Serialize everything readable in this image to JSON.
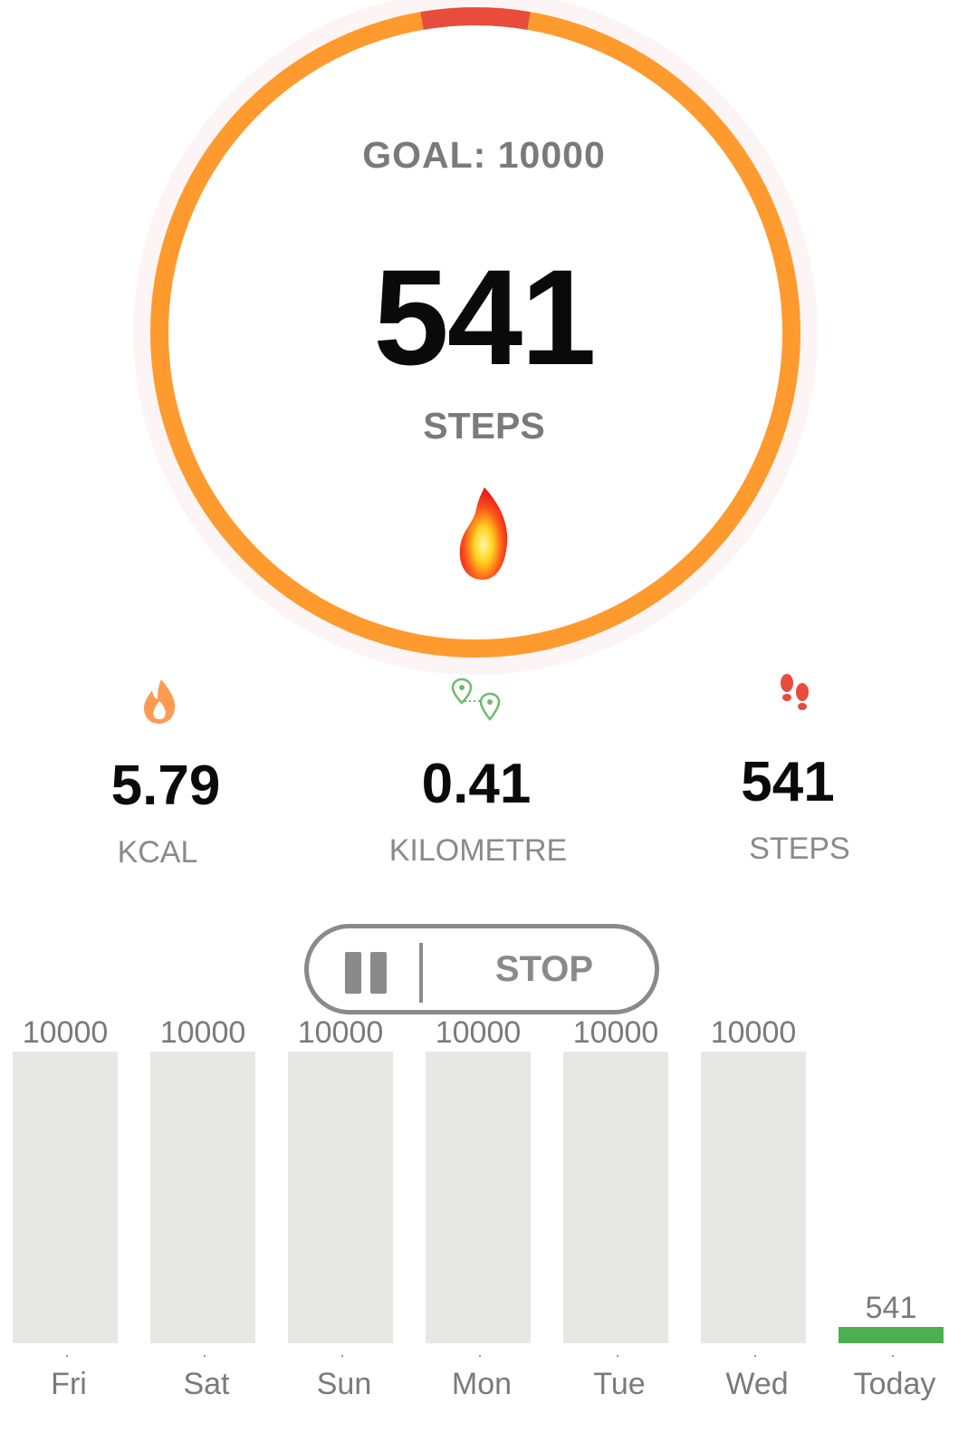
{
  "goal_text": "GOAL: 10000",
  "current_steps": "541",
  "steps_label": "STEPS",
  "progress_fraction": 0.0541,
  "colors": {
    "ring": "#ff9a2e",
    "ring_progress": "#e84c3d",
    "ring_shadow": "#fdf5f5",
    "bar_empty": "#e7e8e6",
    "bar_today": "#4caf50",
    "label_gray": "#8a8a8a"
  },
  "stats": [
    {
      "icon": "fire-icon",
      "value": "5.79",
      "label": "KCAL"
    },
    {
      "icon": "route-pins-icon",
      "value": "0.41",
      "label": "KILOMETRE"
    },
    {
      "icon": "footprints-icon",
      "value": "541",
      "label": "STEPS"
    }
  ],
  "controls": {
    "pause_icon": "pause-icon",
    "stop_label": "STOP"
  },
  "chart_data": {
    "type": "bar",
    "categories": [
      "Fri",
      "Sat",
      "Sun",
      "Mon",
      "Tue",
      "Wed",
      "Today"
    ],
    "values": [
      10000,
      10000,
      10000,
      10000,
      10000,
      10000,
      541
    ],
    "value_labels": [
      "10000",
      "10000",
      "10000",
      "10000",
      "10000",
      "10000",
      "541"
    ],
    "highlight_category": "Today",
    "title": "",
    "xlabel": "",
    "ylabel": "",
    "ylim": [
      0,
      10000
    ],
    "grid": false
  }
}
